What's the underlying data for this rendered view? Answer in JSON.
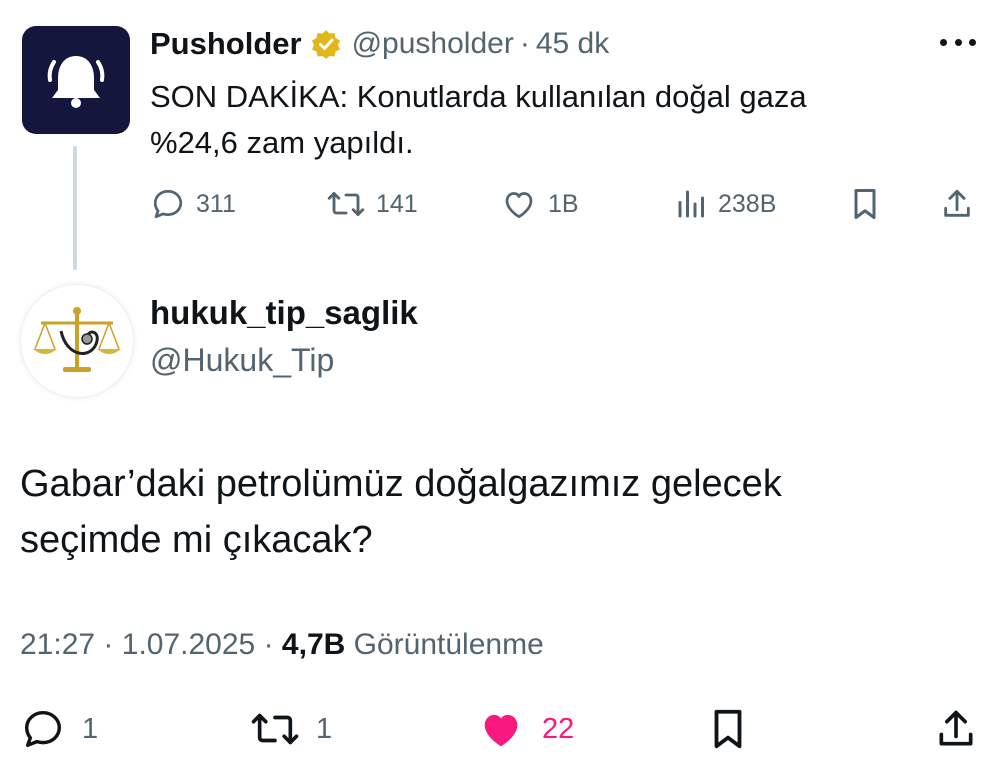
{
  "parent_tweet": {
    "author_name": "Pusholder",
    "handle": "@pusholder",
    "separator": "·",
    "time": "45 dk",
    "text_line1": "SON DAKİKA: Konutlarda kullanılan doğal gaza",
    "text_line2": "%24,6 zam yapıldı.",
    "avatar_icon": "bell-icon",
    "verified_icon": "gold-verified-badge-icon",
    "stats": {
      "replies": "311",
      "retweets": "141",
      "likes": "1B",
      "views": "238B"
    }
  },
  "reply_tweet": {
    "author_name": "hukuk_tip_saglik",
    "handle": "@Hukuk_Tip",
    "avatar_icon": "scales-stethoscope-icon",
    "text_line1": "Gabar’daki petrolümüz doğalgazımız gelecek",
    "text_line2": "seçimde mi çıkacak?",
    "meta": {
      "time": "21:27",
      "sep1": "·",
      "date": "1.07.2025",
      "sep2": "·",
      "views_count": "4,7B",
      "views_label": "Görüntülenme"
    },
    "stats": {
      "replies": "1",
      "retweets": "1",
      "likes": "22",
      "liked": true
    }
  },
  "colors": {
    "text": "#0f1419",
    "secondary": "#536471",
    "like_active": "#f91880",
    "verified_gold": "#e2b719",
    "avatar_bg": "#14163b",
    "thread_line": "#cfd9de"
  }
}
